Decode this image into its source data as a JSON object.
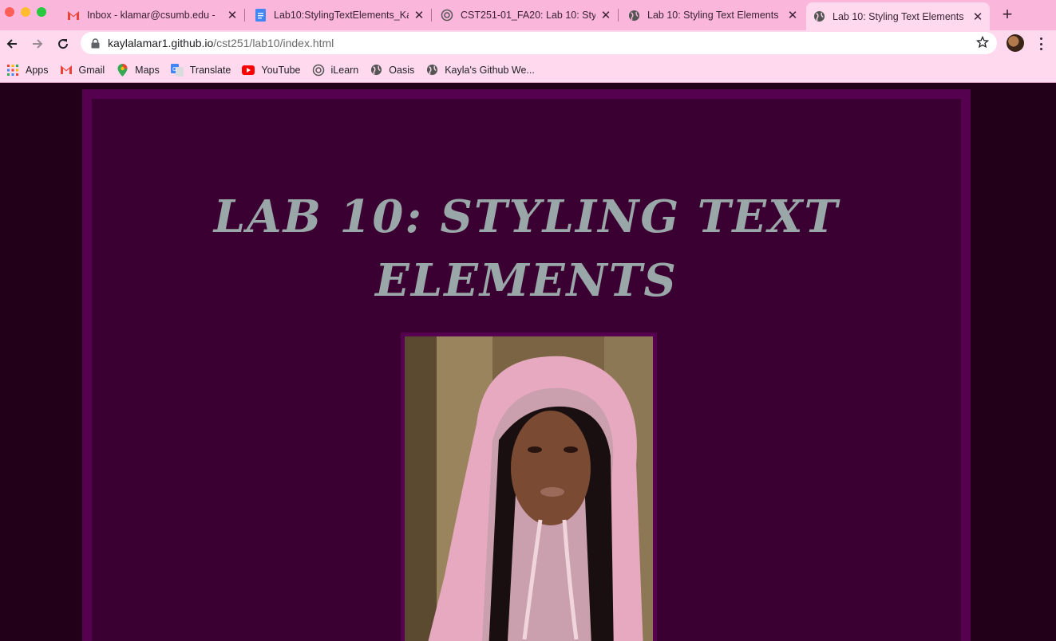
{
  "browser": {
    "tabs": [
      {
        "title": "Inbox - klamar@csumb.edu - ",
        "favicon": "gmail-icon",
        "active": false
      },
      {
        "title": "Lab10:StylingTextElements_Ka",
        "favicon": "google-docs-icon",
        "active": false
      },
      {
        "title": "CST251-01_FA20: Lab 10: Sty",
        "favicon": "ilearn-icon",
        "active": false
      },
      {
        "title": "Lab 10: Styling Text Elements",
        "favicon": "globe-icon",
        "active": false
      },
      {
        "title": "Lab 10: Styling Text Elements",
        "favicon": "globe-icon",
        "active": true
      }
    ],
    "url": {
      "host": "kaylalamar1.github.io",
      "path": "/cst251/lab10/index.html"
    },
    "bookmarks": [
      {
        "label": "Apps",
        "icon": "apps-grid-icon"
      },
      {
        "label": "Gmail",
        "icon": "gmail-icon"
      },
      {
        "label": "Maps",
        "icon": "maps-pin-icon"
      },
      {
        "label": "Translate",
        "icon": "translate-icon"
      },
      {
        "label": "YouTube",
        "icon": "youtube-icon"
      },
      {
        "label": "iLearn",
        "icon": "ilearn-icon"
      },
      {
        "label": "Oasis",
        "icon": "globe-icon"
      },
      {
        "label": "Kayla's Github We...",
        "icon": "globe-icon"
      }
    ]
  },
  "page": {
    "heading_line1": "Lab 10: Styling Text",
    "heading_line2": "Elements"
  },
  "colors": {
    "tabstrip": "#fbb6dc",
    "toolbar": "#ffd9ee",
    "page_bg": "#23001a",
    "frame_border": "#560050",
    "frame_bg": "#3b0032",
    "heading": "#9aa7a8"
  }
}
